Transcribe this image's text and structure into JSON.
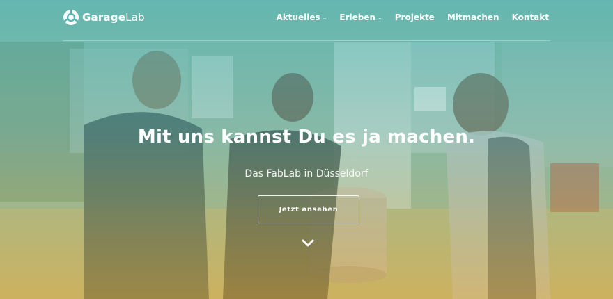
{
  "colors": {
    "top_tint": "#4fb7b4",
    "bottom_tint": "#e7aa3c",
    "text": "#ffffff"
  },
  "brand": {
    "name_bold": "Garage",
    "name_light": "Lab",
    "icon": "garagelab-logo-icon"
  },
  "nav": {
    "items": [
      {
        "label": "Aktuelles",
        "has_dropdown": true
      },
      {
        "label": "Erleben",
        "has_dropdown": true
      },
      {
        "label": "Projekte",
        "has_dropdown": false
      },
      {
        "label": "Mitmachen",
        "has_dropdown": false
      },
      {
        "label": "Kontakt",
        "has_dropdown": false
      }
    ],
    "dropdown_glyph": "⌄"
  },
  "hero": {
    "headline": "Mit uns kannst Du es ja machen.",
    "subline": "Das FabLab in Düsseldorf",
    "cta_label": "Jetzt ansehen",
    "scroll_icon": "chevron-down-icon"
  }
}
